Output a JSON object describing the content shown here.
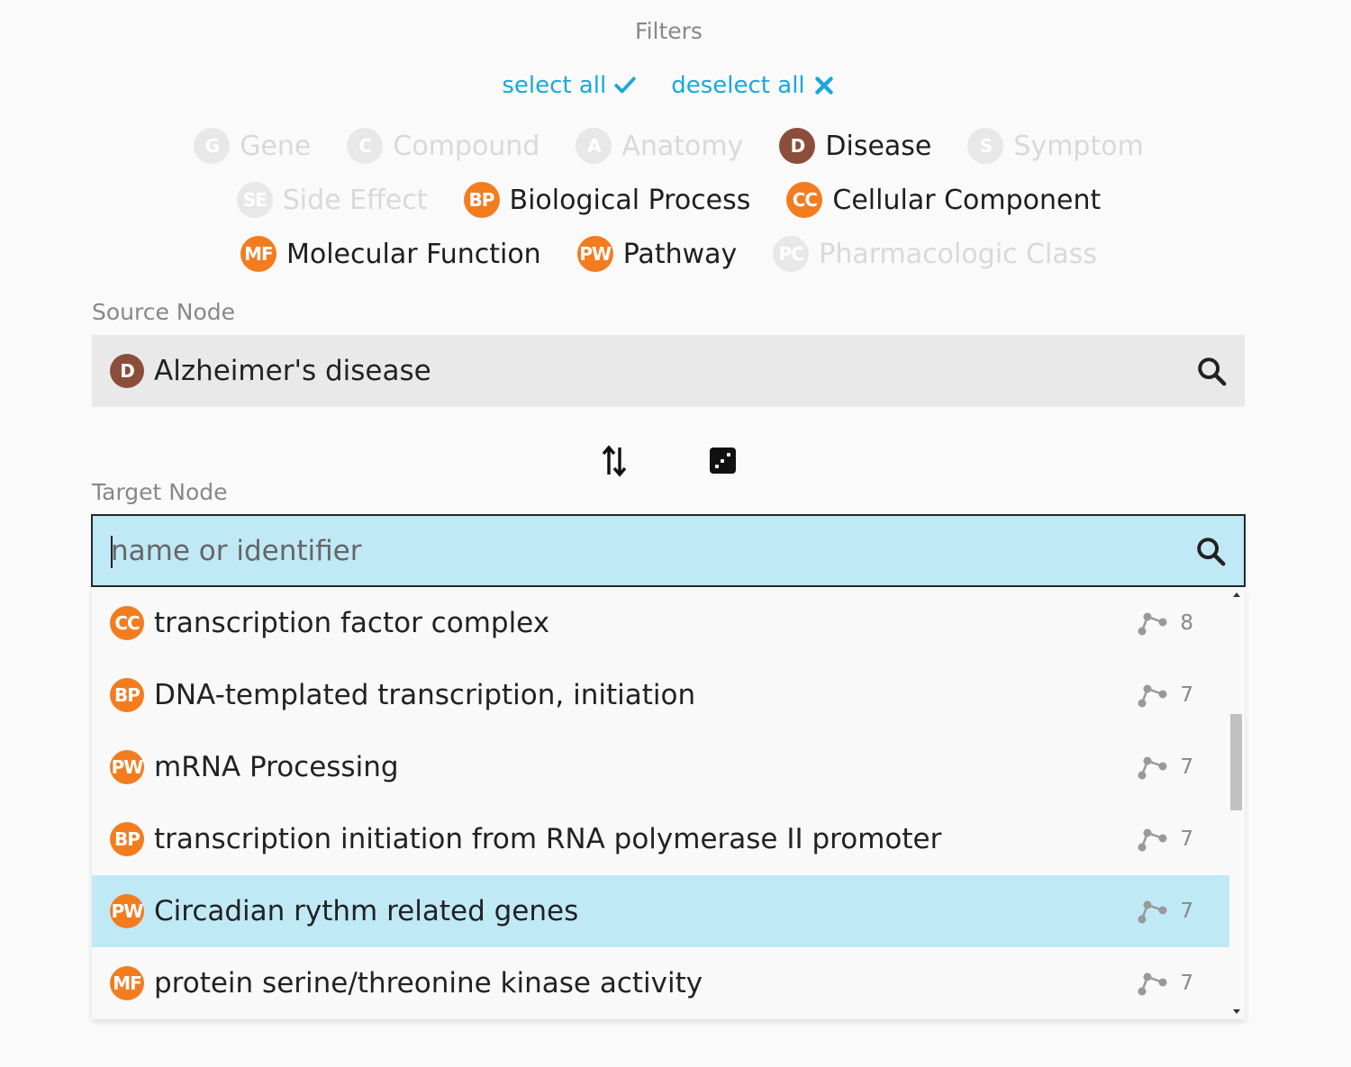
{
  "filters": {
    "title": "Filters",
    "select_all": "select all",
    "deselect_all": "deselect all",
    "rows": [
      [
        {
          "badge": "G",
          "label": "Gene",
          "active": false
        },
        {
          "badge": "C",
          "label": "Compound",
          "active": false
        },
        {
          "badge": "A",
          "label": "Anatomy",
          "active": false
        },
        {
          "badge": "D",
          "label": "Disease",
          "active": true
        },
        {
          "badge": "S",
          "label": "Symptom",
          "active": false
        }
      ],
      [
        {
          "badge": "SE",
          "label": "Side Effect",
          "active": false
        },
        {
          "badge": "BP",
          "label": "Biological Process",
          "active": true
        },
        {
          "badge": "CC",
          "label": "Cellular Component",
          "active": true
        }
      ],
      [
        {
          "badge": "MF",
          "label": "Molecular Function",
          "active": true
        },
        {
          "badge": "PW",
          "label": "Pathway",
          "active": true
        },
        {
          "badge": "PC",
          "label": "Pharmacologic Class",
          "active": false
        }
      ]
    ]
  },
  "source": {
    "label": "Source Node",
    "badge": "D",
    "value": "Alzheimer's disease"
  },
  "target": {
    "label": "Target Node",
    "placeholder": "name or identifier",
    "value": ""
  },
  "results": [
    {
      "badge": "CC",
      "name": "transcription factor complex",
      "count": "8",
      "highlighted": false
    },
    {
      "badge": "BP",
      "name": "DNA-templated transcription, initiation",
      "count": "7",
      "highlighted": false
    },
    {
      "badge": "PW",
      "name": "mRNA Processing",
      "count": "7",
      "highlighted": false
    },
    {
      "badge": "BP",
      "name": "transcription initiation from RNA polymerase II promoter",
      "count": "7",
      "highlighted": false
    },
    {
      "badge": "PW",
      "name": "Circadian rythm related genes",
      "count": "7",
      "highlighted": true
    },
    {
      "badge": "MF",
      "name": "protein serine/threonine kinase activity",
      "count": "7",
      "highlighted": false
    }
  ],
  "colors": {
    "disease": "#8b4e3b",
    "orange": "#f37c1f",
    "link": "#1aa8d9",
    "highlight": "#c0e9f6"
  },
  "icons": {
    "select_all": "check-icon",
    "deselect_all": "x-icon",
    "search": "search-icon",
    "swap": "swap-arrows-icon",
    "random": "dice-icon",
    "metapath": "path-nodes-icon"
  }
}
